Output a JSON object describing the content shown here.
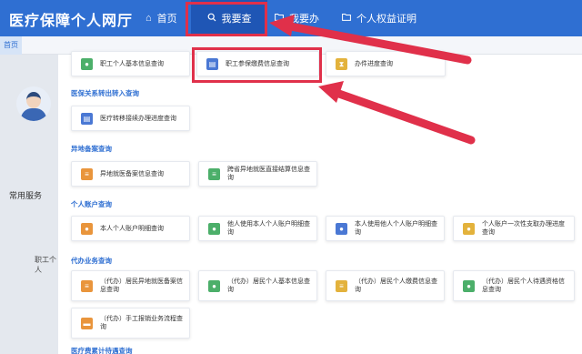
{
  "header": {
    "site_title": "医疗保障个人网厅"
  },
  "nav": {
    "home": {
      "label": "首页",
      "icon": "home-icon"
    },
    "search": {
      "label": "我要查",
      "icon": "search-icon"
    },
    "business": {
      "label": "我要办",
      "icon": "folder-icon"
    },
    "certificate": {
      "label": "个人权益证明",
      "icon": "folder-icon"
    }
  },
  "tabs": {
    "home": "首页"
  },
  "left_panel": {
    "common_services": "常用服务",
    "clipped_item": "职工个人"
  },
  "sections": {
    "basic": {
      "items": [
        {
          "label": "职工个人基本信息查询",
          "icon": "user-icon",
          "color": "#4caf6a"
        },
        {
          "label": "职工参保缴费信息查询",
          "icon": "id-card-icon",
          "color": "#4a78d4"
        },
        {
          "label": "办件进度查询",
          "icon": "hourglass-icon",
          "color": "#e3b23c"
        }
      ]
    },
    "transfer": {
      "title": "医保关系转出转入查询",
      "items": [
        {
          "label": "医疗转移接续办理进度查询",
          "icon": "id-card-icon",
          "color": "#4a78d4"
        }
      ]
    },
    "remote": {
      "title": "异地备案查询",
      "items": [
        {
          "label": "异地就医备案信息查询",
          "icon": "document-icon",
          "color": "#e9953c"
        },
        {
          "label": "跨省异地就医直接结算信息查询",
          "icon": "document-icon",
          "color": "#4caf6a"
        }
      ]
    },
    "account": {
      "title": "个人账户查询",
      "items": [
        {
          "label": "本人个人账户明细查询",
          "icon": "user-icon",
          "color": "#e9953c"
        },
        {
          "label": "他人使用本人个人账户明细查询",
          "icon": "users-icon",
          "color": "#4caf6a"
        },
        {
          "label": "本人使用他人个人账户明细查询",
          "icon": "users-icon",
          "color": "#4a78d4"
        },
        {
          "label": "个人账户一次性支取办理进度查询",
          "icon": "user-icon",
          "color": "#e3b23c"
        }
      ]
    },
    "proxy": {
      "title": "代办业务查询",
      "items": [
        {
          "label": "（代办）居民异地就医备案信息查询",
          "icon": "document-icon",
          "color": "#e9953c"
        },
        {
          "label": "（代办）居民个人基本信息查询",
          "icon": "user-icon",
          "color": "#4caf6a"
        },
        {
          "label": "（代办）居民个人缴费信息查询",
          "icon": "document-icon",
          "color": "#e3b23c"
        },
        {
          "label": "（代办）居民个人待遇资格信息查询",
          "icon": "user-icon",
          "color": "#4caf6a"
        },
        {
          "label": "（代办）手工报销业务流程查询",
          "icon": "chat-icon",
          "color": "#e9953c"
        }
      ]
    },
    "billing": {
      "title": "医疗费累计待遇查询"
    }
  },
  "annotations": {
    "arrow_color": "#e0304a"
  }
}
